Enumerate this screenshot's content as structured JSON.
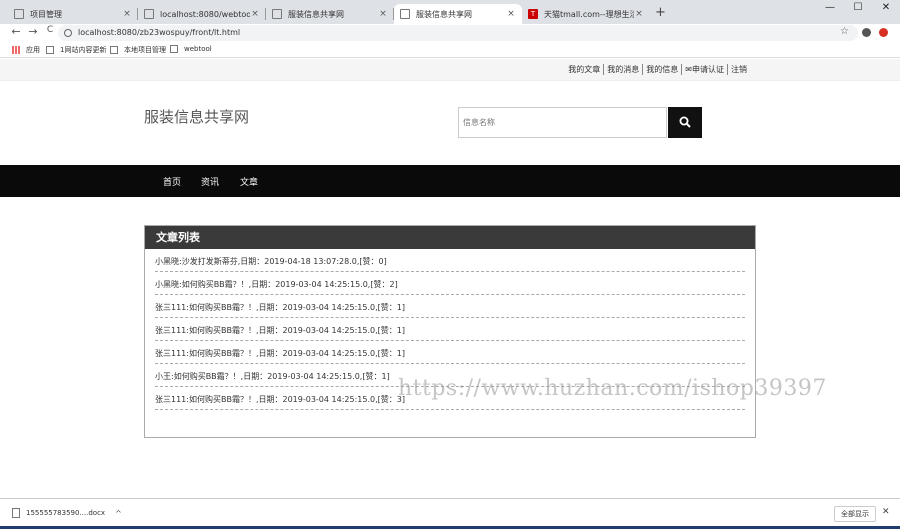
{
  "browser": {
    "tabs": [
      {
        "title": "项目管理",
        "active": false
      },
      {
        "title": "localhost:8080/webtool/all/inc",
        "active": false
      },
      {
        "title": "服装信息共享网",
        "active": false
      },
      {
        "title": "服装信息共享网",
        "active": true
      },
      {
        "title": "天猫tmall.com--理想生活上天猫",
        "active": false
      }
    ],
    "tmall_badge": "T",
    "new_tab": "+",
    "url": "localhost:8080/zb23wospuy/front/lt.html",
    "bookmarks": [
      "应用",
      "1网站内容更新",
      "本地项目管理",
      "webtool"
    ],
    "controls": {
      "minimize": "—",
      "maximize": "☐",
      "close": "✕",
      "back": "←",
      "forward": "→",
      "reload": "C",
      "star": "☆",
      "tab_close": "×"
    }
  },
  "topbar": {
    "links": [
      "我的文章",
      "我的消息",
      "我的信息",
      "✉申请认证",
      "注销"
    ]
  },
  "header": {
    "site_title": "服装信息共享网",
    "search_placeholder": "信息名称"
  },
  "nav": {
    "items": [
      "首页",
      "资讯",
      "文章"
    ]
  },
  "article_list": {
    "title": "文章列表",
    "rows": [
      "小黑晓:沙发打发斯蒂芬,日期：2019-04-18 13:07:28.0,[赞：0]",
      "小黑晓:如何购买BB霜？！,日期：2019-03-04 14:25:15.0,[赞：2]",
      "张三111:如何购买BB霜？！,日期：2019-03-04 14:25:15.0,[赞：1]",
      "张三111:如何购买BB霜？！,日期：2019-03-04 14:25:15.0,[赞：1]",
      "张三111:如何购买BB霜？！,日期：2019-03-04 14:25:15.0,[赞：1]",
      "小王:如何购买BB霜？！,日期：2019-03-04 14:25:15.0,[赞：1]",
      "张三111:如何购买BB霜？！,日期：2019-03-04 14:25:15.0,[赞：3]"
    ]
  },
  "watermark": "https://www.huzhan.com/ishop39397",
  "download_bar": {
    "file": "155555783590....docx",
    "chevron": "^",
    "show_all": "全部显示",
    "close": "✕"
  }
}
